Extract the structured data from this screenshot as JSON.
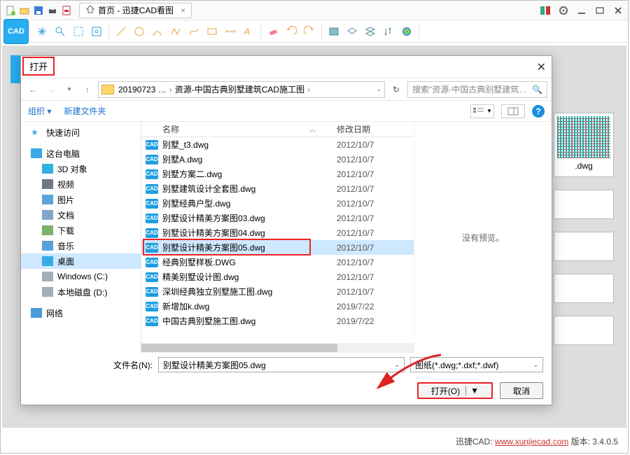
{
  "app": {
    "logo_text": "CAD",
    "tab_title": "首页 - 迅捷CAD看图",
    "tab_suffix": "×"
  },
  "footer": {
    "prefix": "迅捷CAD: ",
    "url": "www.xunjiecad.com",
    "version_label": " 版本: ",
    "version": "3.4.0.5"
  },
  "bg": {
    "thumb_label": ".dwg"
  },
  "dialog": {
    "title": "打开",
    "breadcrumb": [
      "20190723 …",
      "资源-中国古典别墅建筑CAD施工图"
    ],
    "search_placeholder": "搜索\"资源-中国古典别墅建筑…",
    "tool_organize": "组织 ▾",
    "tool_newfolder": "新建文件夹",
    "col_name": "名称",
    "col_date": "修改日期",
    "preview_text": "没有预览。",
    "filename_label": "文件名(N):",
    "filename_value": "别墅设计精美方案图05.dwg",
    "filter_value": "图纸(*.dwg;*.dxf;*.dwf)",
    "open_btn": "打开(O)",
    "cancel_btn": "取消"
  },
  "tree": [
    {
      "icon": "star",
      "label": "快速访问"
    },
    {
      "icon": "pc",
      "label": "这台电脑"
    },
    {
      "icon": "3d",
      "label": "3D 对象",
      "sub": true
    },
    {
      "icon": "vid",
      "label": "视频",
      "sub": true
    },
    {
      "icon": "img",
      "label": "图片",
      "sub": true
    },
    {
      "icon": "doc",
      "label": "文档",
      "sub": true
    },
    {
      "icon": "dl",
      "label": "下载",
      "sub": true
    },
    {
      "icon": "mus",
      "label": "音乐",
      "sub": true
    },
    {
      "icon": "desk",
      "label": "桌面",
      "sub": true,
      "selected": true
    },
    {
      "icon": "drive",
      "label": "Windows (C:)",
      "sub": true
    },
    {
      "icon": "drive",
      "label": "本地磁盘 (D:)",
      "sub": true
    },
    {
      "icon": "net",
      "label": "网络"
    }
  ],
  "files": [
    {
      "name": "别墅_t3.dwg",
      "date": "2012/10/7"
    },
    {
      "name": "别墅A.dwg",
      "date": "2012/10/7"
    },
    {
      "name": "别墅方案二.dwg",
      "date": "2012/10/7"
    },
    {
      "name": "别墅建筑设计全套图.dwg",
      "date": "2012/10/7"
    },
    {
      "name": "别墅经典户型.dwg",
      "date": "2012/10/7"
    },
    {
      "name": "别墅设计精美方案图03.dwg",
      "date": "2012/10/7"
    },
    {
      "name": "别墅设计精美方案图04.dwg",
      "date": "2012/10/7"
    },
    {
      "name": "别墅设计精美方案图05.dwg",
      "date": "2012/10/7",
      "selected": true
    },
    {
      "name": "经典别墅样板.DWG",
      "date": "2012/10/7"
    },
    {
      "name": "精美别墅设计图.dwg",
      "date": "2012/10/7"
    },
    {
      "name": "深圳经典独立别墅施工图.dwg",
      "date": "2012/10/7"
    },
    {
      "name": "新增加k.dwg",
      "date": "2019/7/22"
    },
    {
      "name": "中国古典别墅施工图.dwg",
      "date": "2019/7/22"
    }
  ]
}
